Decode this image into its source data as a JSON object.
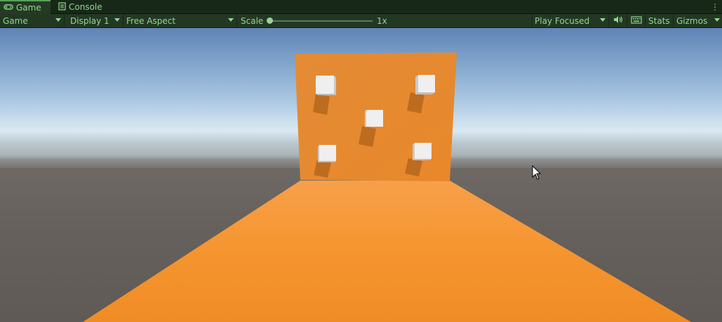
{
  "tabs": [
    {
      "label": "Game",
      "icon": "gamepad-icon",
      "active": true
    },
    {
      "label": "Console",
      "icon": "console-icon",
      "active": false
    }
  ],
  "toolbar": {
    "view_select": "Game",
    "display_select": "Display 1",
    "aspect_select": "Free Aspect",
    "scale_label": "Scale",
    "scale_value": "1x",
    "play_mode_select": "Play Focused",
    "audio_icon": "speaker-icon",
    "stats_icon": "keyboard-icon",
    "stats_label": "Stats",
    "gizmos_label": "Gizmos",
    "scale_level": 0.0
  },
  "colors": {
    "editor_accent": "#8fd88f",
    "floor": "#f2922b",
    "wall": "#e68a2e",
    "cube": "#ececec"
  },
  "scene": {
    "objects": [
      "floor-plane",
      "back-wall",
      "cube",
      "cube",
      "cube",
      "cube",
      "cube"
    ]
  }
}
